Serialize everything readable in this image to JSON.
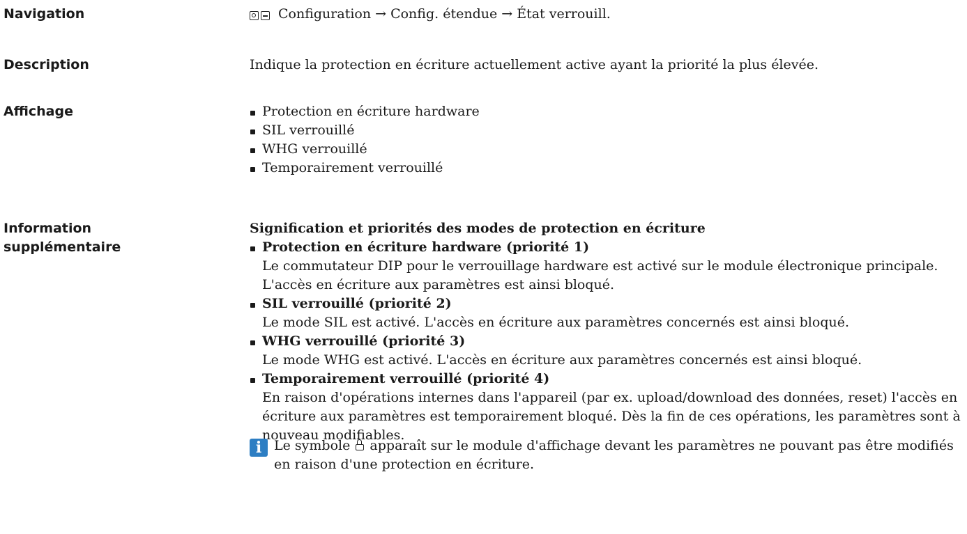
{
  "navigation": {
    "label": "Navigation",
    "path": "Configuration → Config. étendue → État verrouill."
  },
  "description": {
    "label": "Description",
    "text": "Indique la protection en écriture actuellement active ayant la priorité la plus élevée."
  },
  "display": {
    "label": "Affichage",
    "items": [
      "Protection en écriture hardware",
      "SIL verrouillé",
      "WHG verrouillé",
      "Temporairement verrouillé"
    ]
  },
  "additional": {
    "label_line1": "Information",
    "label_line2": "supplémentaire",
    "heading": "Signification et priorités des modes de protection en écriture",
    "items": [
      {
        "title": "Protection en écriture hardware (priorité 1)",
        "text": "Le commutateur DIP pour le verrouillage hardware est activé sur le module électronique principale. L'accès en écriture aux paramètres est ainsi bloqué."
      },
      {
        "title": "SIL verrouillé (priorité 2)",
        "text": "Le mode SIL est activé. L'accès en écriture aux paramètres concernés est ainsi bloqué."
      },
      {
        "title": "WHG verrouillé (priorité 3)",
        "text": "Le mode WHG est activé. L'accès en écriture aux paramètres concernés est ainsi bloqué."
      },
      {
        "title": "Temporairement verrouillé (priorité 4)",
        "text": "En raison d'opérations internes dans l'appareil (par ex. upload/download des données, reset) l'accès en écriture aux paramètres est temporairement bloqué. Dès la fin de ces opérations, les paramètres sont à nouveau modifiables."
      }
    ]
  },
  "note": {
    "icon": "info-icon",
    "icon_letter": "i",
    "text_before": "Le symbole",
    "text_after": "apparaît sur le module d'affichage devant les paramètres ne pouvant pas être modifiés en raison d'une protection en écriture."
  },
  "colors": {
    "info_icon_bg": "#2d7ec3",
    "text": "#1a1a1a"
  }
}
